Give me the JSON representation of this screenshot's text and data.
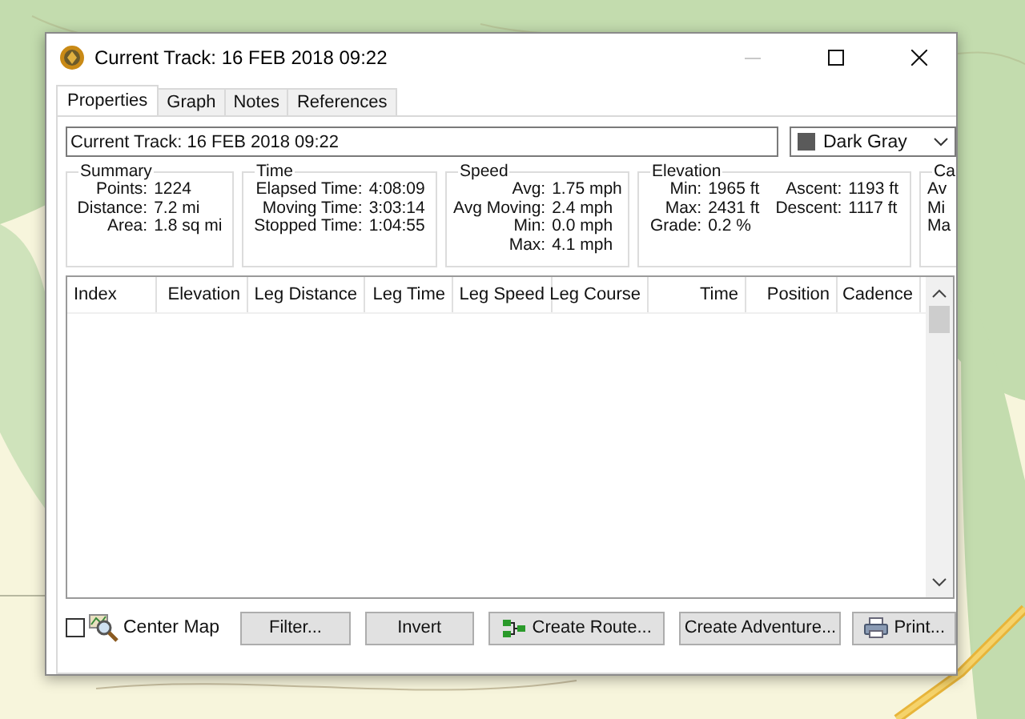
{
  "window": {
    "title": "Current Track: 16 FEB 2018 09:22",
    "controls": [
      {
        "kind": "minimize",
        "disabled": true
      },
      {
        "kind": "maximize",
        "disabled": false
      },
      {
        "kind": "close",
        "disabled": false
      }
    ]
  },
  "tabs": [
    {
      "label": "Properties",
      "selected": true
    },
    {
      "label": "Graph",
      "selected": false
    },
    {
      "label": "Notes",
      "selected": false
    },
    {
      "label": "References",
      "selected": false
    }
  ],
  "name_field": {
    "value": "Current Track: 16 FEB 2018 09:22"
  },
  "color_dropdown": {
    "label": "Dark Gray",
    "color": "#5a5a5a"
  },
  "groups": [
    {
      "title": "Summary",
      "rows": [
        [
          {
            "label": "Points:",
            "value": "1224"
          }
        ],
        [
          {
            "label": "Distance:",
            "value": "7.2 mi"
          }
        ],
        [
          {
            "label": "Area:",
            "value": "1.8 sq mi"
          }
        ]
      ]
    },
    {
      "title": "Time",
      "rows": [
        [
          {
            "label": "Elapsed Time:",
            "value": "4:08:09"
          }
        ],
        [
          {
            "label": "Moving Time:",
            "value": "3:03:14"
          }
        ],
        [
          {
            "label": "Stopped Time:",
            "value": "1:04:55"
          }
        ]
      ]
    },
    {
      "title": "Speed",
      "rows": [
        [
          {
            "label": "Avg:",
            "value": "1.75 mph"
          }
        ],
        [
          {
            "label": "Avg Moving:",
            "value": "2.4 mph"
          }
        ],
        [
          {
            "label": "Min:",
            "value": "0.0 mph"
          }
        ],
        [
          {
            "label": "Max:",
            "value": "4.1 mph"
          }
        ]
      ]
    },
    {
      "title": "Elevation",
      "rows": [
        [
          {
            "label": "Min:",
            "value": "1965 ft"
          },
          {
            "label": "Ascent:",
            "value": "1193 ft"
          }
        ],
        [
          {
            "label": "Max:",
            "value": "2431 ft"
          },
          {
            "label": "Descent:",
            "value": "1117 ft"
          }
        ],
        [
          {
            "label": "Grade:",
            "value": "0.2 %"
          }
        ]
      ]
    },
    {
      "title": "Ca",
      "rows": [
        [
          {
            "label": "Av"
          }
        ],
        [
          {
            "label": "Mi"
          }
        ],
        [
          {
            "label": "Ma"
          }
        ]
      ]
    }
  ],
  "table": {
    "columns": [
      "Index",
      "Elevation",
      "Leg Distance",
      "Leg Time",
      "Leg Speed",
      "Leg Course",
      "Time",
      "Position",
      "Cadence"
    ]
  },
  "center_map": {
    "label": "Center Map",
    "checked": false
  },
  "buttons": [
    {
      "label": "Filter...",
      "kind": "plain"
    },
    {
      "label": "Invert",
      "kind": "plain"
    },
    {
      "label": "Create Route...",
      "kind": "route"
    },
    {
      "label": "Create Adventure...",
      "kind": "plain"
    },
    {
      "label": "Print...",
      "kind": "print"
    }
  ]
}
